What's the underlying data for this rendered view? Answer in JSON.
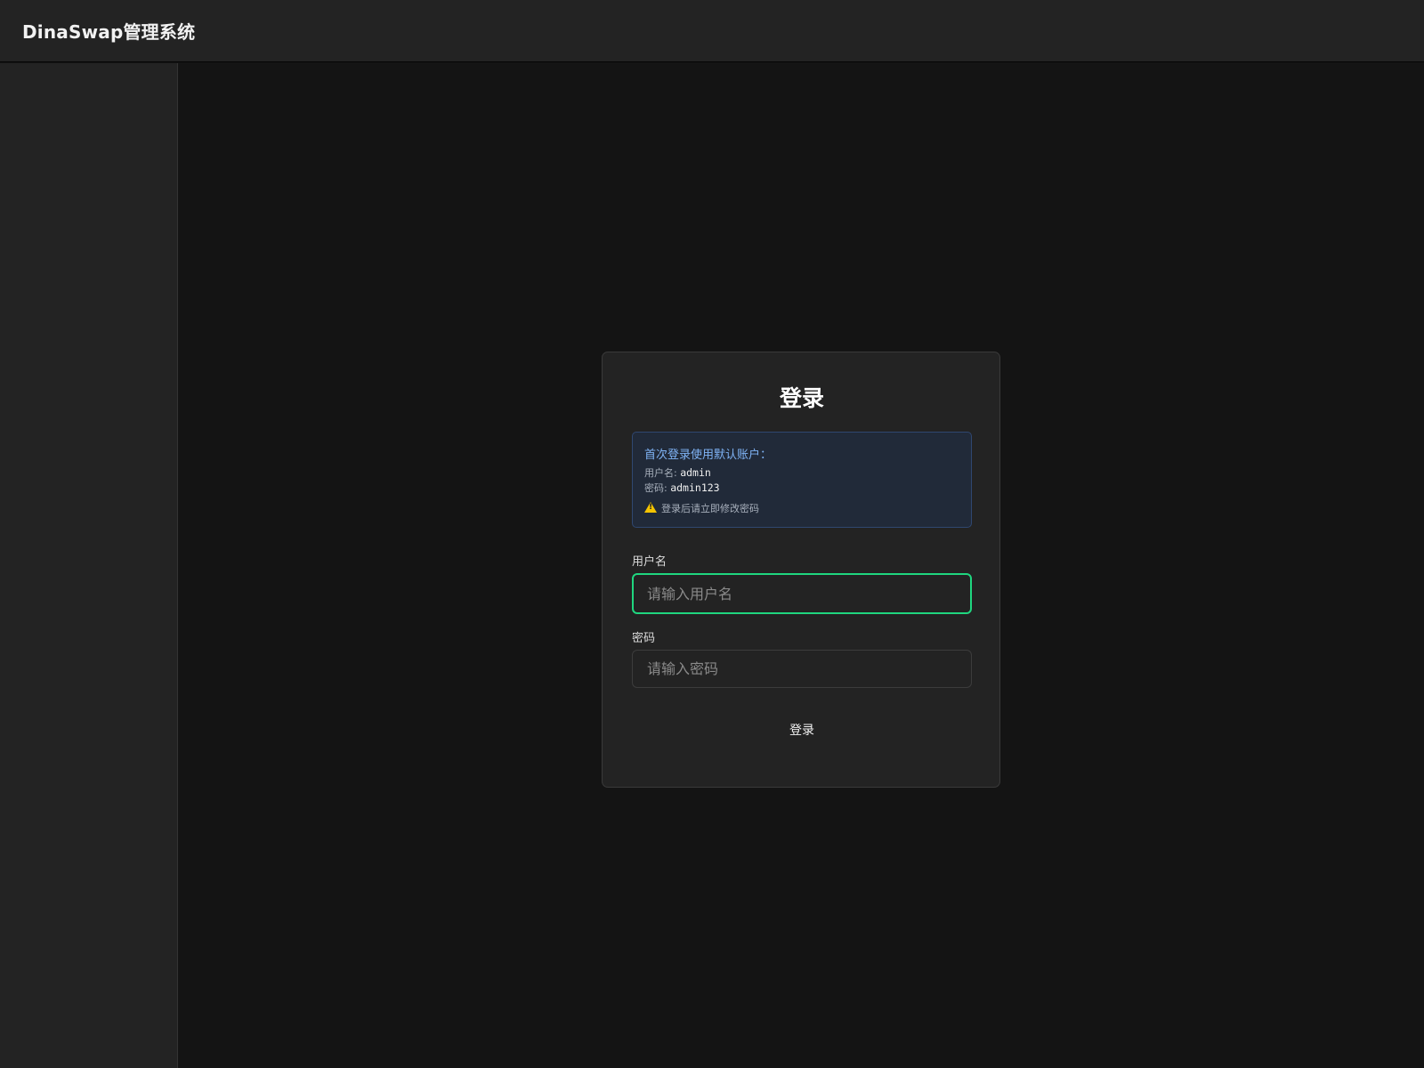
{
  "app": {
    "title": "DinaSwap管理系统"
  },
  "login": {
    "title": "登录",
    "notice": {
      "heading": "首次登录使用默认账户：",
      "username_label": "用户名: ",
      "username_value": "admin",
      "password_label": "密码: ",
      "password_value": "admin123",
      "warning": "登录后请立即修改密码"
    },
    "username": {
      "label": "用户名",
      "value": "",
      "placeholder": "请输入用户名"
    },
    "password": {
      "label": "密码",
      "value": "",
      "placeholder": "请输入密码"
    },
    "submit_label": "登录"
  },
  "colors": {
    "accent_focus": "#1fd67f",
    "notice_text": "#7fb3f5",
    "warning": "#f5c400"
  },
  "icons": {
    "warning": "warning-icon"
  }
}
